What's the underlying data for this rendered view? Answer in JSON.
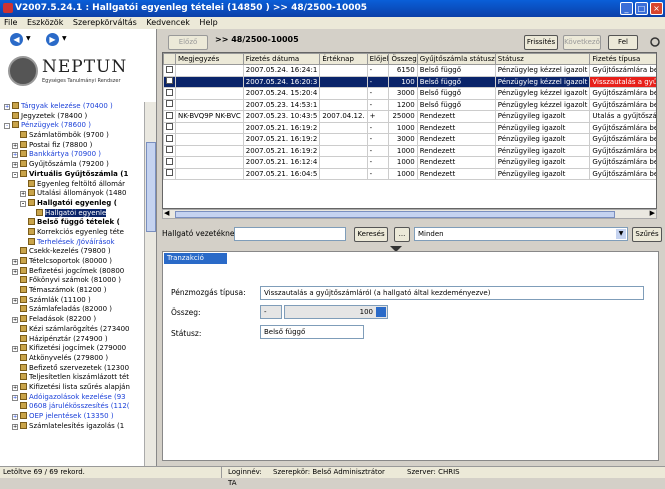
{
  "window": {
    "title": "V2007.5.24.1 : Hallgatói egyenleg tételei (14850   )  >> 48/2500-10005"
  },
  "menu": [
    "File",
    "Eszközök",
    "Szerepkörváltás",
    "Kedvencek",
    "Help"
  ],
  "logo": {
    "name": "NEPTUN",
    "subtitle": "Egységes Tanulmányi Rendszer"
  },
  "tree": [
    {
      "label": "Tárgyak kelezése (70400 )",
      "level": 0,
      "style": "blue",
      "pm": "+"
    },
    {
      "label": "Jegyzetek (78400 )",
      "level": 0,
      "style": "",
      "pm": ""
    },
    {
      "label": "Pénzügyek (78600 )",
      "level": 0,
      "style": "blue",
      "pm": "-"
    },
    {
      "label": "Számlatömbök (9700 )",
      "level": 1,
      "style": "",
      "pm": ""
    },
    {
      "label": "Postai fiz (78800 )",
      "level": 1,
      "style": "",
      "pm": "+"
    },
    {
      "label": "Bankkártya (70900 )",
      "level": 1,
      "style": "blue",
      "pm": "+"
    },
    {
      "label": "Gyűjtőszámla (79200 )",
      "level": 1,
      "style": "",
      "pm": "+"
    },
    {
      "label": "Virtuális Gyűjtőszámla (1",
      "level": 1,
      "style": "bold",
      "pm": "-"
    },
    {
      "label": "Egyenleg feltöltő állomár",
      "level": 2,
      "style": "",
      "pm": ""
    },
    {
      "label": "Utalási állományok (1480",
      "level": 2,
      "style": "",
      "pm": "+"
    },
    {
      "label": "Hallgatói egyenleg (",
      "level": 2,
      "style": "bold",
      "pm": "-"
    },
    {
      "label": "Hallgatói egyenle",
      "level": 3,
      "style": "sel",
      "pm": ""
    },
    {
      "label": "Belső függő tételek (",
      "level": 2,
      "style": "bold",
      "pm": ""
    },
    {
      "label": "Korrekciós egyenleg téte",
      "level": 2,
      "style": "",
      "pm": ""
    },
    {
      "label": "Terhelések /Jóváírások",
      "level": 2,
      "style": "blue",
      "pm": ""
    },
    {
      "label": "Csekk-kezelés (79800 )",
      "level": 1,
      "style": "",
      "pm": ""
    },
    {
      "label": "Tételcsoportok (80000 )",
      "level": 1,
      "style": "",
      "pm": "+"
    },
    {
      "label": "Befizetési jogcímek (80800",
      "level": 1,
      "style": "",
      "pm": "+"
    },
    {
      "label": "Főkönyvi számok (81000 )",
      "level": 1,
      "style": "",
      "pm": ""
    },
    {
      "label": "Témaszámok (81200 )",
      "level": 1,
      "style": "",
      "pm": ""
    },
    {
      "label": "Számlák (11100 )",
      "level": 1,
      "style": "",
      "pm": "+"
    },
    {
      "label": "Számlafeladás (82000 )",
      "level": 1,
      "style": "",
      "pm": ""
    },
    {
      "label": "Feladások (82200 )",
      "level": 1,
      "style": "",
      "pm": "+"
    },
    {
      "label": "Kézi számlarögzítés (273400",
      "level": 1,
      "style": "",
      "pm": ""
    },
    {
      "label": "Házipénztár (274900 )",
      "level": 1,
      "style": "",
      "pm": ""
    },
    {
      "label": "Kifizetési jogcímek (279000",
      "level": 1,
      "style": "",
      "pm": "+"
    },
    {
      "label": "Átkönyvelés (279800 )",
      "level": 1,
      "style": "",
      "pm": ""
    },
    {
      "label": "Befizető szervezetek (12300",
      "level": 1,
      "style": "",
      "pm": ""
    },
    {
      "label": "Teljesítetlen kiszámlázott tét",
      "level": 1,
      "style": "",
      "pm": ""
    },
    {
      "label": "Kifizetési lista szűrés alapján",
      "level": 1,
      "style": "",
      "pm": "+"
    },
    {
      "label": "Adóigazolások kezelése (93",
      "level": 1,
      "style": "blue",
      "pm": "+"
    },
    {
      "label": "0608 járulékösszesítés (112(",
      "level": 1,
      "style": "blue",
      "pm": ""
    },
    {
      "label": "OEP jelentések (13350 )",
      "level": 1,
      "style": "blue",
      "pm": "+"
    },
    {
      "label": "Számlatelesítés igazolás (1",
      "level": 1,
      "style": "",
      "pm": "+"
    }
  ],
  "toolbar": {
    "back": "Előző",
    "record_path": ">> 48/2500-10005",
    "refresh": "Frissítés",
    "next": "Következő",
    "up": "Fel"
  },
  "grid": {
    "columns": [
      "",
      "Megjegyzés",
      "Fizetés dátuma",
      "Értéknap",
      "Előjel",
      "Összeg",
      "Gyűjtőszámla státusz",
      "Státusz",
      "Fizetés típusa"
    ],
    "rows": [
      {
        "check": false,
        "note": "",
        "date": "2007.05.24. 16:24:1",
        "value": "",
        "sign": "-",
        "amount": "6150",
        "gy_status": "Belső függő",
        "status": "Pénzügyleg kézzel igazolt",
        "type": "Gyűjtőszámlára befizeté",
        "selected": false,
        "red": false
      },
      {
        "check": false,
        "note": "",
        "date": "2007.05.24. 16:20:3",
        "value": "",
        "sign": "-",
        "amount": "100",
        "gy_status": "Belső függő",
        "status": "Pénzügyleg kézzel igazolt",
        "type": "Visszautalás a gyűjtősz",
        "selected": true,
        "red": true
      },
      {
        "check": false,
        "note": "",
        "date": "2007.05.24. 15:20:4",
        "value": "",
        "sign": "-",
        "amount": "3000",
        "gy_status": "Belső függő",
        "status": "Pénzügyleg kézzel igazolt",
        "type": "Gyűjtőszámlára befizeté",
        "selected": false,
        "red": false
      },
      {
        "check": false,
        "note": "",
        "date": "2007.05.23. 14:53:1",
        "value": "",
        "sign": "-",
        "amount": "1200",
        "gy_status": "Belső függő",
        "status": "Pénzügyleg kézzel igazolt",
        "type": "Gyűjtőszámlára befizeté",
        "selected": false,
        "red": false
      },
      {
        "check": false,
        "note": "NK-BVQ9P NK-BVC",
        "date": "2007.05.23. 10:43:5",
        "value": "2007.04.12.",
        "sign": "+",
        "amount": "25000",
        "gy_status": "Rendezett",
        "status": "Pénzügyileg igazolt",
        "type": "Utalás a gyűjtőszámlár",
        "selected": false,
        "red": false
      },
      {
        "check": false,
        "note": "",
        "date": "2007.05.21. 16:19:2",
        "value": "",
        "sign": "-",
        "amount": "1000",
        "gy_status": "Rendezett",
        "status": "Pénzügyileg igazolt",
        "type": "Gyűjtőszámlára befizeté",
        "selected": false,
        "red": false
      },
      {
        "check": false,
        "note": "",
        "date": "2007.05.21. 16:19:2",
        "value": "",
        "sign": "-",
        "amount": "3000",
        "gy_status": "Rendezett",
        "status": "Pénzügyileg igazolt",
        "type": "Gyűjtőszámlára befizeté",
        "selected": false,
        "red": false
      },
      {
        "check": false,
        "note": "",
        "date": "2007.05.21. 16:19:2",
        "value": "",
        "sign": "-",
        "amount": "1000",
        "gy_status": "Rendezett",
        "status": "Pénzügyileg igazolt",
        "type": "Gyűjtőszámlára befizeté",
        "selected": false,
        "red": false
      },
      {
        "check": false,
        "note": "",
        "date": "2007.05.21. 16:12:4",
        "value": "",
        "sign": "-",
        "amount": "1000",
        "gy_status": "Rendezett",
        "status": "Pénzügyileg igazolt",
        "type": "Gyűjtőszámlára befizeté",
        "selected": false,
        "red": false
      },
      {
        "check": false,
        "note": "",
        "date": "2007.05.21. 16:04:5",
        "value": "",
        "sign": "-",
        "amount": "1000",
        "gy_status": "Rendezett",
        "status": "Pénzügyileg igazolt",
        "type": "Gyűjtőszámlára befizeté",
        "selected": false,
        "red": false
      }
    ]
  },
  "filter": {
    "label": "Hallgató vezetékne",
    "search": "Keresés",
    "dots": "...",
    "select_value": "Minden",
    "filter_btn": "Szűrés"
  },
  "detail": {
    "tab": "Tranzakció adatai",
    "mode_label": "Pénzmozgás típusa:",
    "mode_value": "Visszautalás a gyűjtőszámláról (a hallgató által kezdeményezve)",
    "amount_label": "Összeg:",
    "sign_value": "-",
    "amount_value": "100",
    "status_label": "Státusz:",
    "status_value": "Belső függő"
  },
  "statusbar": {
    "records": "Letöltve 69 / 69 rekord.",
    "login": "Loginnév: TA",
    "role": "Szerepkör: Belső Adminisztrátor",
    "server": "Szerver: CHRIS"
  },
  "colors": {
    "title": "#0b4fc8",
    "selection": "#0a246a",
    "red": "#e7201a",
    "tab": "#2a6ac8"
  }
}
